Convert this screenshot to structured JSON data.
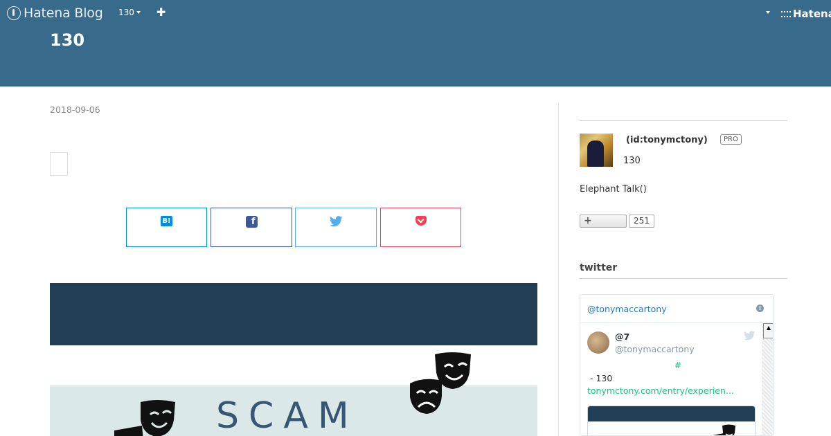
{
  "global_header": {
    "logo_text": "Hatena Blog",
    "blog_menu_label": "130",
    "add_label": "✚",
    "right_brand": "Hatena"
  },
  "blog": {
    "title": "130",
    "header_color": "#386b8b"
  },
  "article": {
    "date": "2018-09-06",
    "share_buttons": [
      {
        "name": "hatena-bookmark",
        "color": "#008fde",
        "icon": "B!"
      },
      {
        "name": "facebook",
        "color": "#3b5998",
        "icon": "f"
      },
      {
        "name": "twitter",
        "color": "#55acee",
        "icon": "twitter-bird-icon"
      },
      {
        "name": "pocket",
        "color": "#ef4056",
        "icon": "pocket-icon"
      }
    ],
    "banner_text": "SCAM"
  },
  "sidebar": {
    "profile": {
      "id_label": "(id:tonymctony)",
      "badge": "PRO",
      "title": "130",
      "description": "Elephant Talk()",
      "follow_label": "+",
      "follower_count": "251"
    },
    "twitter_section": {
      "heading": "twitter",
      "widget_handle": "@tonymaccartony",
      "tweet": {
        "name": "@7",
        "handle": "@tonymaccartony",
        "hashtag": "#",
        "text": "- 130",
        "link": "tonymctony.com/entry/experien..."
      }
    }
  }
}
